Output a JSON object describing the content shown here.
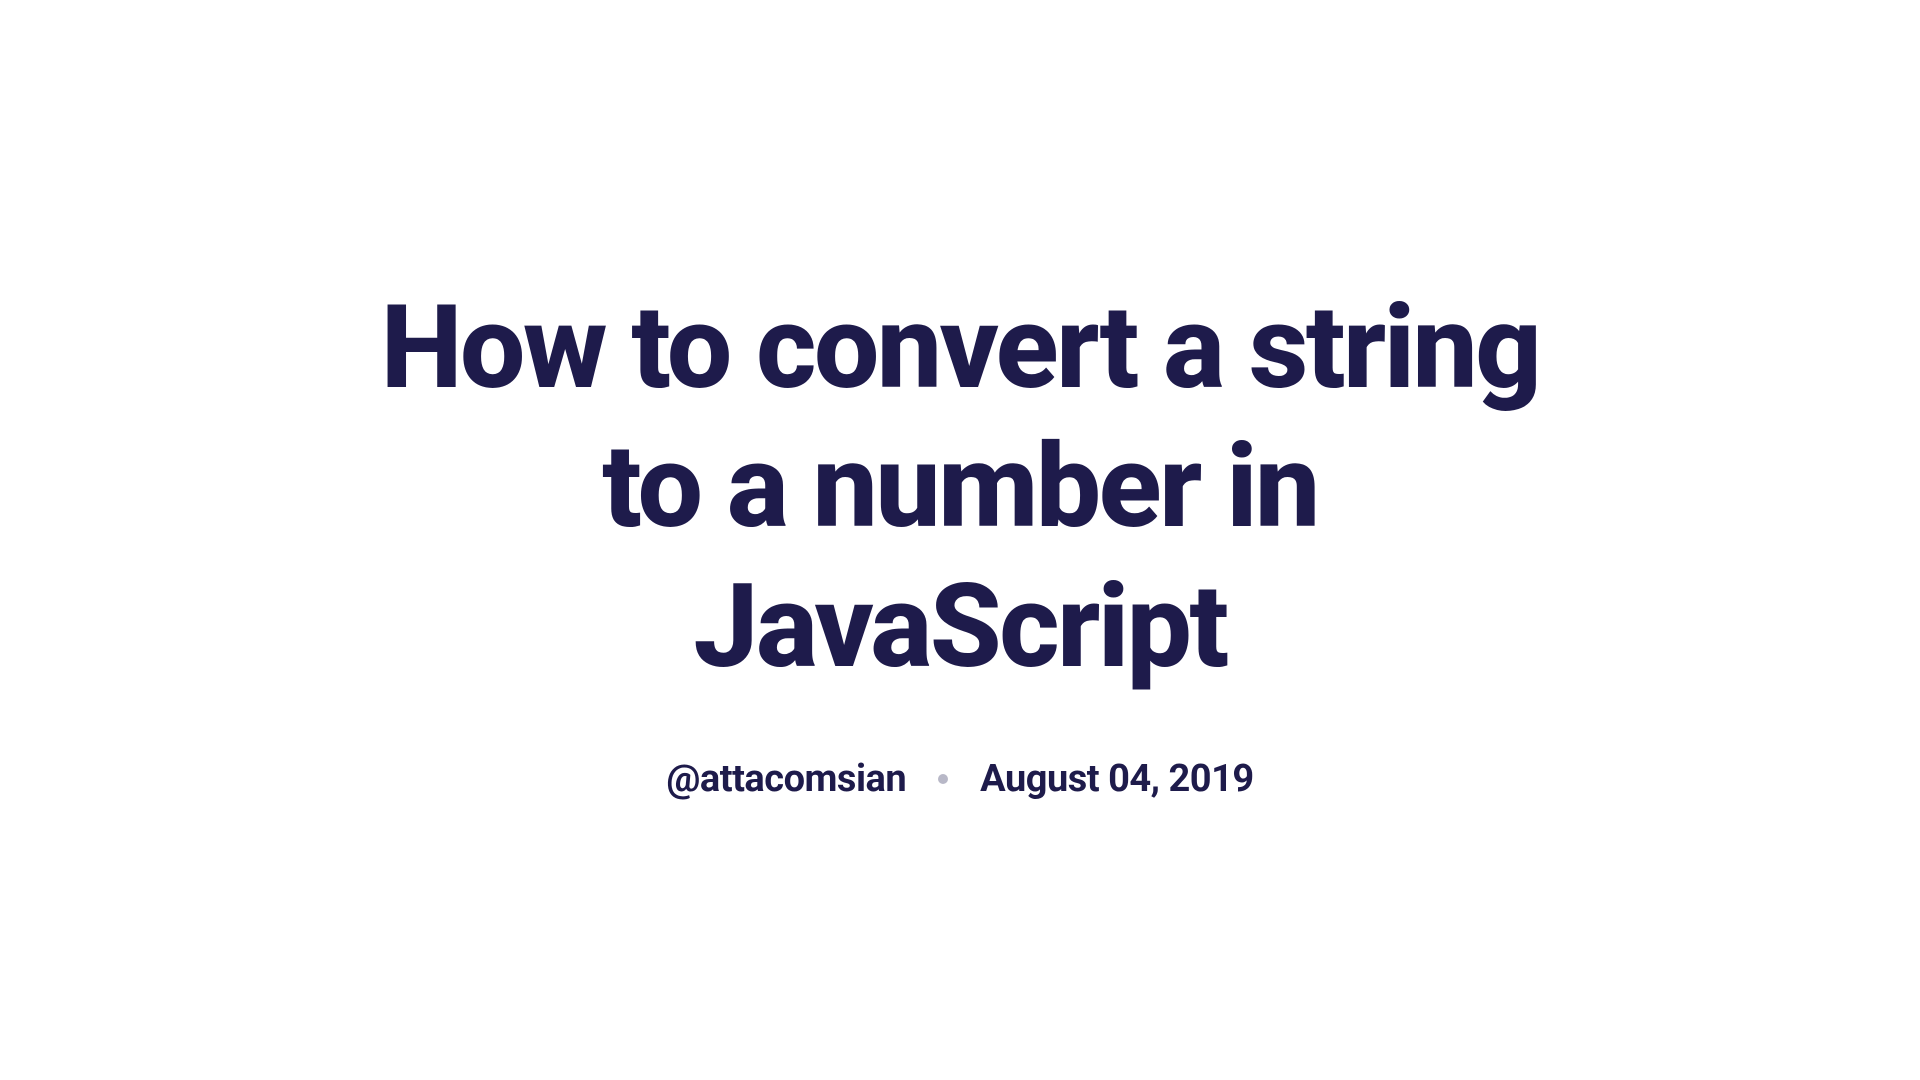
{
  "article": {
    "title": "How to convert a string to a number in JavaScript",
    "author": "@attacomsian",
    "date": "August 04, 2019"
  }
}
